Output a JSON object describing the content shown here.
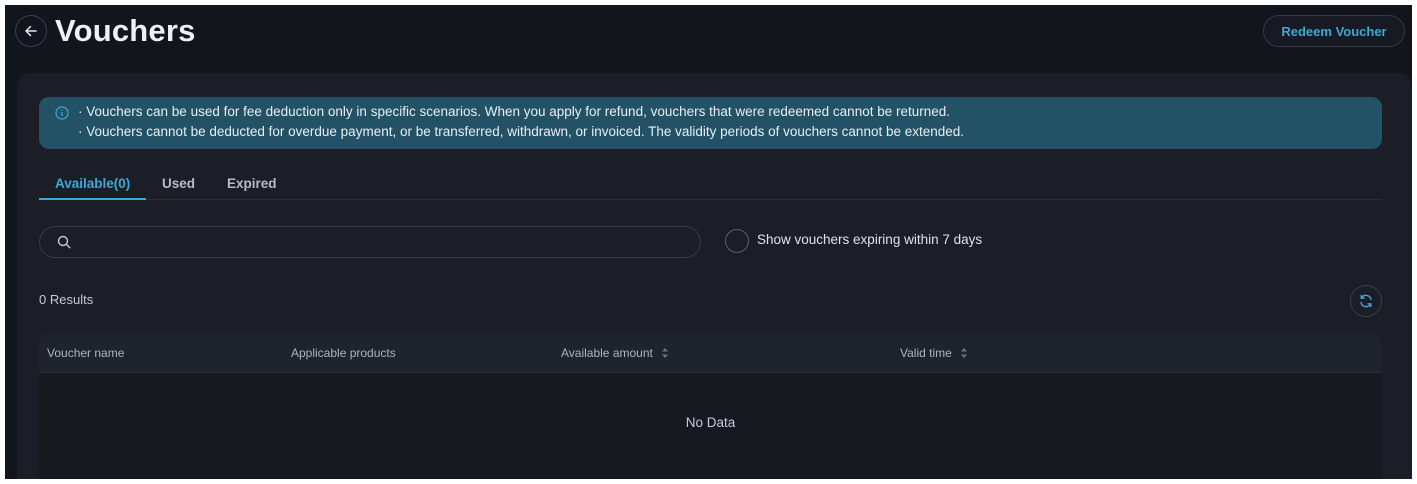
{
  "header": {
    "title": "Vouchers",
    "redeem_button": "Redeem Voucher"
  },
  "notice": {
    "lines": [
      "· Vouchers can be used for fee deduction only in specific scenarios. When you apply for refund, vouchers that were redeemed cannot be returned.",
      "· Vouchers cannot be deducted for overdue payment, or be transferred, withdrawn, or invoiced. The validity periods of vouchers cannot be extended."
    ],
    "icon": "info-icon"
  },
  "tabs": [
    {
      "label": "Available(0)",
      "active": true
    },
    {
      "label": "Used",
      "active": false
    },
    {
      "label": "Expired",
      "active": false
    }
  ],
  "filters": {
    "search_value": "",
    "expiring_label": "Show vouchers expiring within 7 days",
    "expiring_checked": false
  },
  "results_text": "0 Results",
  "table": {
    "columns": [
      {
        "label": "Voucher name",
        "sortable": false
      },
      {
        "label": "Applicable products",
        "sortable": false
      },
      {
        "label": "Available amount",
        "sortable": true
      },
      {
        "label": "Valid time",
        "sortable": true
      }
    ],
    "rows": [],
    "empty_text": "No Data"
  },
  "colors": {
    "accent": "#3fa7d6",
    "background": "#13151d",
    "panel": "#1b1e27",
    "notice_bg": "#235266"
  }
}
